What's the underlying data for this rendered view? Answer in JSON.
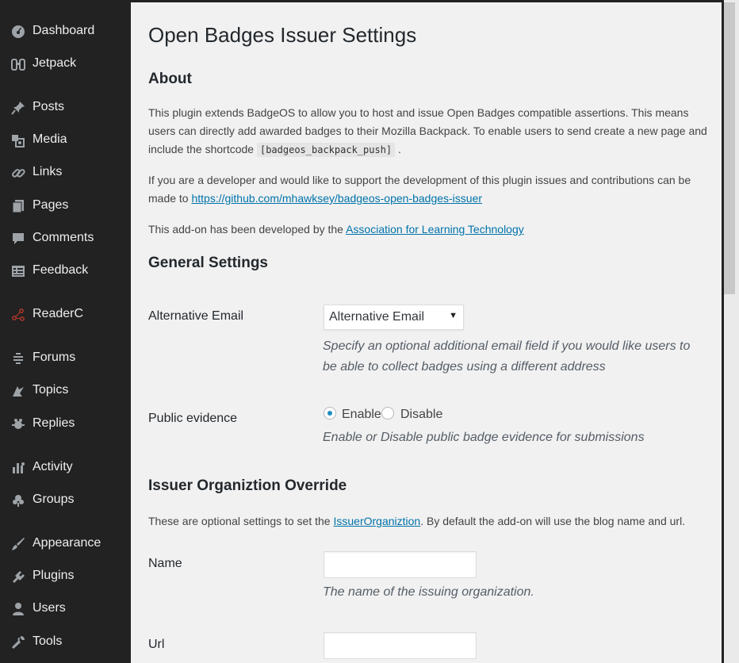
{
  "sidebar": {
    "items": [
      {
        "label": "Dashboard",
        "icon": "dashboard-icon"
      },
      {
        "label": "Jetpack",
        "icon": "jetpack-icon"
      },
      {
        "label": "Posts",
        "icon": "pin-icon"
      },
      {
        "label": "Media",
        "icon": "media-icon"
      },
      {
        "label": "Links",
        "icon": "link-icon"
      },
      {
        "label": "Pages",
        "icon": "pages-icon"
      },
      {
        "label": "Comments",
        "icon": "comment-icon"
      },
      {
        "label": "Feedback",
        "icon": "feedback-icon"
      },
      {
        "label": "ReaderC",
        "icon": "reader-icon"
      },
      {
        "label": "Forums",
        "icon": "forums-icon"
      },
      {
        "label": "Topics",
        "icon": "topics-icon"
      },
      {
        "label": "Replies",
        "icon": "replies-icon"
      },
      {
        "label": "Activity",
        "icon": "activity-icon"
      },
      {
        "label": "Groups",
        "icon": "groups-icon"
      },
      {
        "label": "Appearance",
        "icon": "brush-icon"
      },
      {
        "label": "Plugins",
        "icon": "plug-icon"
      },
      {
        "label": "Users",
        "icon": "user-icon"
      },
      {
        "label": "Tools",
        "icon": "wrench-icon"
      }
    ]
  },
  "page": {
    "title": "Open Badges Issuer Settings",
    "about_heading": "About",
    "about_p1": "This plugin extends BadgeOS to allow you to host and issue Open Badges compatible assertions. This means users can directly add awarded badges to their Mozilla Backpack. To enable users to send create a new page and include the shortcode",
    "shortcode": "[badgeos_backpack_push]",
    "about_p1_end": ".",
    "about_p2": "If you are a developer and would like to support the development of this plugin issues and contributions can be made to",
    "github_link": "https://github.com/mhawksey/badgeos-open-badges-issuer",
    "about_p3": "This add-on has been developed by the",
    "alt_link": "Association for Learning Technology",
    "general_heading": "General Settings",
    "alt_email_label": "Alternative Email",
    "alt_email_value": "Alternative Email",
    "alt_email_desc": "Specify an optional additional email field if you would like users to be able to collect badges using a different address",
    "public_evidence_label": "Public evidence",
    "enable_label": "Enable",
    "disable_label": "Disable",
    "public_evidence_selected": "Enable",
    "public_evidence_desc": "Enable or Disable public badge evidence for submissions",
    "issuer_heading": "Issuer Organiztion Override",
    "issuer_p_start": "These are optional settings to set the",
    "issuer_link": "IssuerOrganiztion",
    "issuer_p_end": ". By default the add-on will use the blog name and url.",
    "name_label": "Name",
    "name_value": "",
    "name_desc": "The name of the issuing organization.",
    "url_label": "Url",
    "url_value": ""
  },
  "colors": {
    "sidebar_bg": "#222222",
    "content_bg": "#f1f1f1",
    "link": "#0073aa",
    "radio_checked": "#1e8cbe"
  }
}
